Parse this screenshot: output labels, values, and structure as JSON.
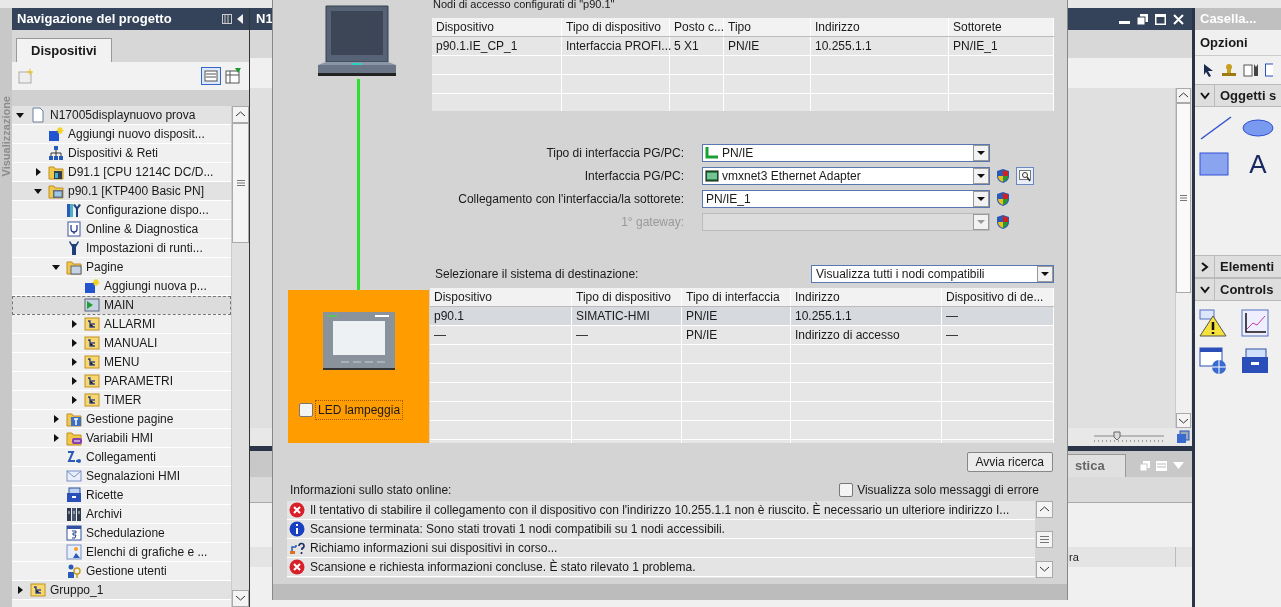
{
  "side_strip": {
    "title": "Visualizzazione"
  },
  "project_nav": {
    "title": "Navigazione del progetto",
    "tabs": [
      {
        "label": "Dispositivi",
        "selected": true
      }
    ],
    "tree": [
      {
        "label": "N17005displaynuovo prova",
        "kind": "document",
        "expanded": true,
        "selected": false,
        "children": [
          {
            "label": "Aggiungi nuovo disposit...",
            "kind": "add",
            "selected": false
          },
          {
            "label": "Dispositivi & Reti",
            "kind": "network",
            "selected": false
          },
          {
            "label": "D91.1 [CPU 1214C DC/D...",
            "kind": "plc",
            "expanded": false,
            "selected": false
          },
          {
            "label": "p90.1 [KTP400 Basic PN]",
            "kind": "hmi",
            "expanded": true,
            "selected": false,
            "children": [
              {
                "label": "Configurazione dispo...",
                "kind": "config",
                "selected": false
              },
              {
                "label": "Online & Diagnostica",
                "kind": "diagnostics",
                "selected": false
              },
              {
                "label": "Impostazioni di runti...",
                "kind": "runtime",
                "selected": false
              },
              {
                "label": "Pagine",
                "kind": "folder",
                "expanded": true,
                "selected": false,
                "children": [
                  {
                    "label": "Aggiungi nuova p...",
                    "kind": "add",
                    "selected": false
                  },
                  {
                    "label": "MAIN",
                    "kind": "screen",
                    "selected": true
                  },
                  {
                    "label": "ALLARMI",
                    "kind": "group",
                    "expanded": false,
                    "selected": false
                  },
                  {
                    "label": "MANUALI",
                    "kind": "group",
                    "expanded": false,
                    "selected": false
                  },
                  {
                    "label": "MENU",
                    "kind": "group",
                    "expanded": false,
                    "selected": false
                  },
                  {
                    "label": "PARAMETRI",
                    "kind": "group",
                    "expanded": false,
                    "selected": false
                  },
                  {
                    "label": "TIMER",
                    "kind": "group",
                    "expanded": false,
                    "selected": false
                  }
                ]
              },
              {
                "label": "Gestione pagine",
                "kind": "screen-management",
                "expanded": false,
                "selected": false
              },
              {
                "label": "Variabili HMI",
                "kind": "tags",
                "expanded": false,
                "selected": false
              },
              {
                "label": "Collegamenti",
                "kind": "connections",
                "selected": false
              },
              {
                "label": "Segnalazioni HMI",
                "kind": "envelope",
                "selected": false
              },
              {
                "label": "Ricette",
                "kind": "recipes",
                "selected": false
              },
              {
                "label": "Archivi",
                "kind": "archives",
                "selected": false
              },
              {
                "label": "Schedulazione",
                "kind": "scheduler",
                "selected": false
              },
              {
                "label": "Elenchi di grafiche e ...",
                "kind": "text-lists",
                "selected": false
              },
              {
                "label": "Gestione utenti",
                "kind": "users",
                "selected": false
              }
            ]
          }
        ]
      },
      {
        "label": "Gruppo_1",
        "kind": "group",
        "expanded": false,
        "selected": false
      }
    ]
  },
  "editor": {
    "title": "N1",
    "lower_tab": "stica",
    "lower_cell": "ra"
  },
  "dialog": {
    "configured_title": "Nodi di accesso configurati di \"p90.1\"",
    "configured_table": {
      "columns": [
        "Dispositivo",
        "Tipo di dispositivo",
        "Posto c...",
        "Tipo",
        "Indirizzo",
        "Sottorete"
      ],
      "rows": [
        [
          "p90.1.IE_CP_1",
          "Interfaccia PROFI...",
          "5 X1",
          "PN/IE",
          "10.255.1.1",
          "PN/IE_1"
        ]
      ]
    },
    "form": [
      {
        "label": "Tipo di interfaccia PG/PC:",
        "value": "PN/IE",
        "kind": "pnie",
        "disabled": false,
        "shield": false,
        "search": false
      },
      {
        "label": "Interfaccia PG/PC:",
        "value": "vmxnet3 Ethernet Adapter",
        "kind": "adapter",
        "disabled": false,
        "shield": true,
        "search": true
      },
      {
        "label": "Collegamento con l'interfaccia/la sottorete:",
        "value": "PN/IE_1",
        "kind": "plain",
        "disabled": false,
        "shield": true,
        "search": false
      },
      {
        "label": "1° gateway:",
        "kind": "plain",
        "disabled": true,
        "shield": true,
        "search": false
      }
    ],
    "target_label": "Selezionare il sistema di destinazione:",
    "target_filter": "Visualizza tutti i nodi compatibili",
    "led_checkbox": {
      "label": "LED lampeggia",
      "checked": false
    },
    "target_table": {
      "columns": [
        "Dispositivo",
        "Tipo di dispositivo",
        "Tipo di interfaccia",
        "Indirizzo",
        "Dispositivo di de..."
      ],
      "rows": [
        {
          "cells": [
            "p90.1",
            "SIMATIC-HMI",
            "PN/IE",
            "10.255.1.1",
            "—"
          ],
          "selected": true
        },
        {
          "cells": [
            "—",
            "—",
            "PN/IE",
            "Indirizzo di accesso",
            "—"
          ],
          "selected": false
        }
      ]
    },
    "search_button": "Avvia ricerca",
    "status_label": "Informazioni sullo stato online:",
    "errors_only": {
      "label": "Visualizza solo messaggi di errore",
      "checked": false
    },
    "messages": [
      {
        "kind": "error",
        "text": "Il tentativo di stabilire il collegamento con il dispositivo con l'indirizzo 10.255.1.1 non è riuscito. È necessario un ulteriore indirizzo I..."
      },
      {
        "kind": "info",
        "text": "Scansione terminata: Sono stati trovati 1 nodi compatibili su 1 nodi accessibili."
      },
      {
        "kind": "query",
        "text": "Richiamo informazioni sui dispositivi in corso..."
      },
      {
        "kind": "error",
        "text": "Scansione e richiesta informazioni concluse. È stato rilevato 1 problema."
      }
    ]
  },
  "toolbox": {
    "title": "Casella...",
    "options": "Opzioni",
    "sections": [
      {
        "label": "Oggetti s",
        "expanded": true,
        "items": [
          {
            "kind": "line"
          },
          {
            "kind": "ellipse"
          },
          {
            "kind": "rectangle"
          },
          {
            "kind": "text",
            "label": "A"
          }
        ]
      },
      {
        "label": "Elementi",
        "expanded": false
      },
      {
        "label": "Controls",
        "expanded": true,
        "items": [
          {
            "kind": "alarm-view"
          },
          {
            "kind": "trend-view"
          },
          {
            "kind": "web-view"
          },
          {
            "kind": "recipe-view"
          }
        ]
      }
    ]
  }
}
